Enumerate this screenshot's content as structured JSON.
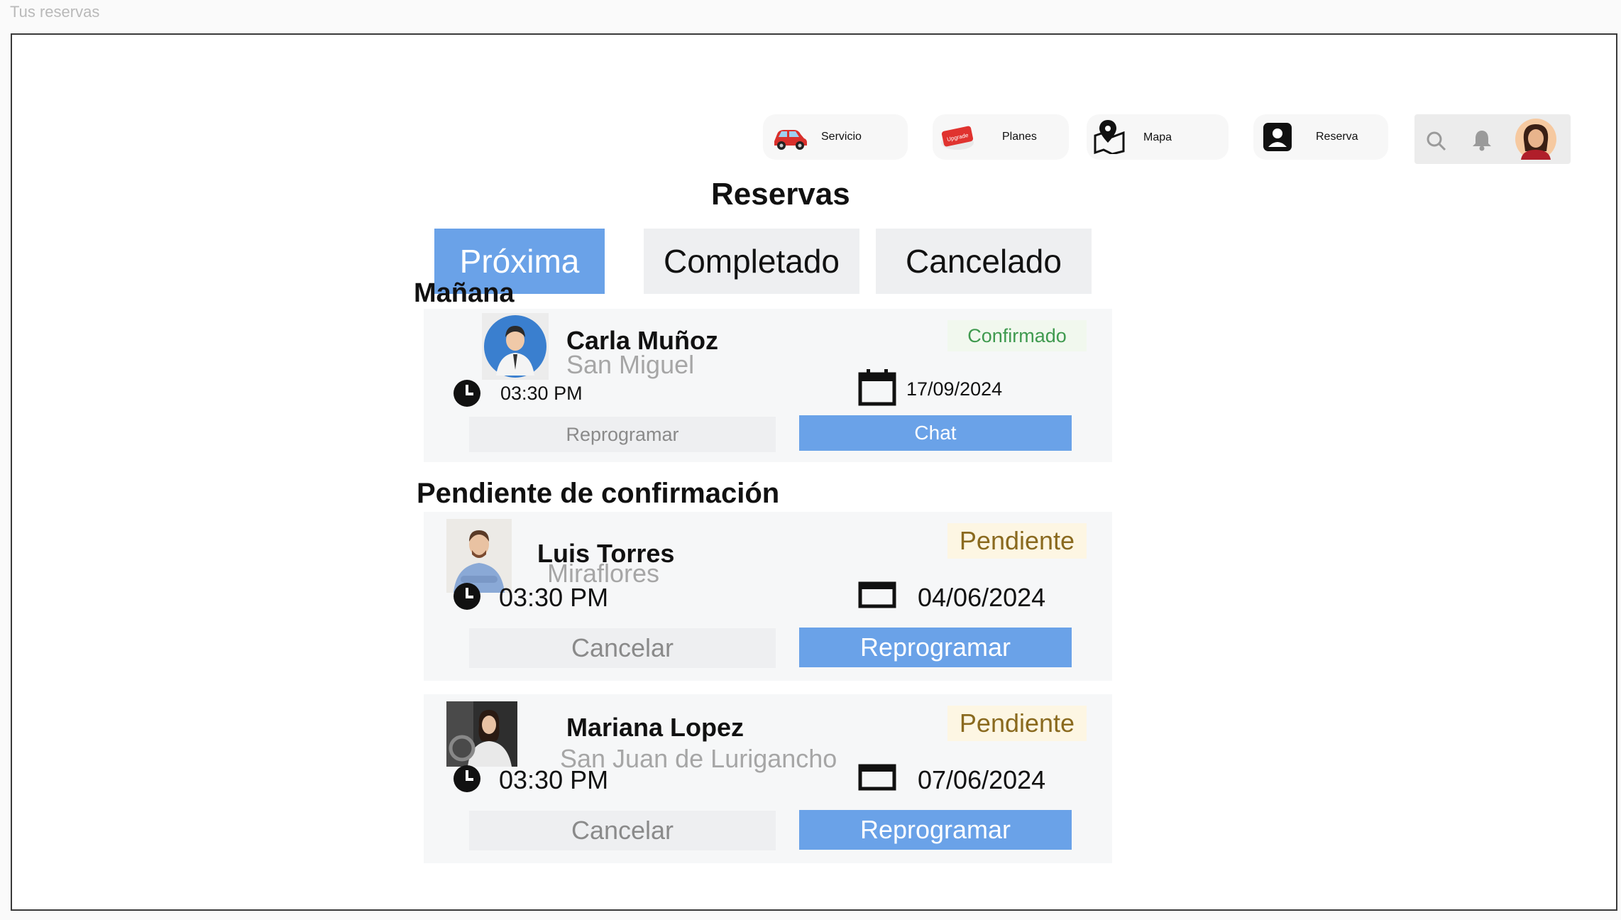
{
  "frame_label": "Tus reservas",
  "nav": {
    "servicio": "Servicio",
    "planes": "Planes",
    "planes_badge": "Upgrade",
    "mapa": "Mapa",
    "reserva": "Reserva"
  },
  "page_title": "Reservas",
  "tabs": [
    {
      "label": "Próxima",
      "active": true
    },
    {
      "label": "Completado",
      "active": false
    },
    {
      "label": "Cancelado",
      "active": false
    }
  ],
  "sections": {
    "tomorrow": "Mañana",
    "pending": "Pendiente de confirmación"
  },
  "bookings": [
    {
      "name": "Carla Muñoz",
      "district": "San Miguel",
      "status": "Confirmado",
      "time": "03:30 PM",
      "date": "17/09/2024",
      "secondary_action": "Reprogramar",
      "primary_action": "Chat"
    },
    {
      "name": "Luis Torres",
      "district": "Miraflores",
      "status": "Pendiente",
      "time": "03:30 PM",
      "date": "04/06/2024",
      "secondary_action": "Cancelar",
      "primary_action": "Reprogramar"
    },
    {
      "name": "Mariana Lopez",
      "district": "San Juan de Lurigancho",
      "status": "Pendiente",
      "time": "03:30 PM",
      "date": "07/06/2024",
      "secondary_action": "Cancelar",
      "primary_action": "Reprogramar"
    }
  ],
  "colors": {
    "accent": "#6aa2e8",
    "confirmed_text": "#3f9a4f",
    "pending_text": "#8a6a1f",
    "pending_bg": "#fdf6e3",
    "confirmed_bg": "#f1f8ee"
  }
}
